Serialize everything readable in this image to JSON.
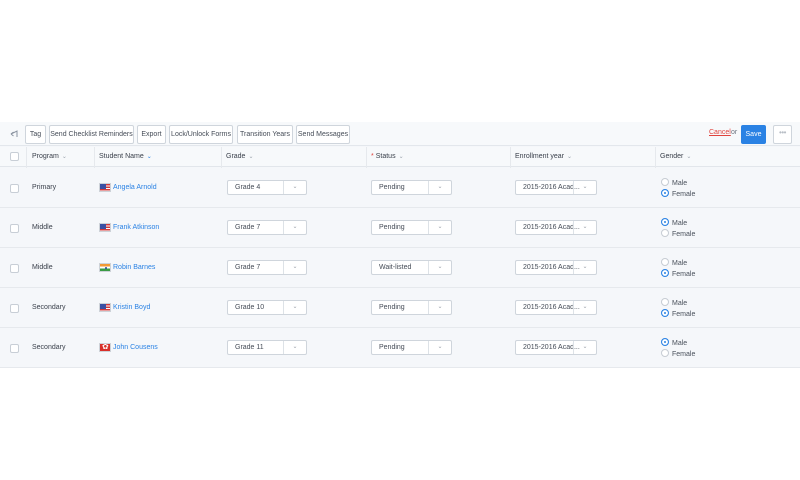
{
  "toolbar": {
    "buttons": [
      "Tag",
      "Send Checklist Reminders",
      "Export",
      "Lock/Unlock Forms",
      "Transition Years",
      "Send Messages"
    ],
    "cancel_label": "Cancel",
    "or_label": "or",
    "save_label": "Save",
    "more_label": "•••",
    "back_icon": "back-arrow-icon"
  },
  "table": {
    "columns": {
      "program": "Program",
      "student_name": "Student Name",
      "grade": "Grade",
      "status": "Status",
      "enrollment_year": "Enrollment year",
      "gender": "Gender"
    },
    "required_mark": "*",
    "gender_options": [
      "Male",
      "Female"
    ],
    "rows": [
      {
        "program": "Primary",
        "name": "Angela Arnold",
        "flag": "us-flag-icon",
        "grade": "Grade 4",
        "status": "Pending",
        "enrollment_year": "2015-2016 Acad...",
        "gender": "Female"
      },
      {
        "program": "Middle",
        "name": "Frank Atkinson",
        "flag": "us-flag-icon",
        "grade": "Grade 7",
        "status": "Pending",
        "enrollment_year": "2015-2016 Acad...",
        "gender": "Male"
      },
      {
        "program": "Middle",
        "name": "Robin Barnes",
        "flag": "india-flag-icon",
        "grade": "Grade 7",
        "status": "Wait-listed",
        "enrollment_year": "2015-2016 Acad...",
        "gender": "Female"
      },
      {
        "program": "Secondary",
        "name": "Kristin Boyd",
        "flag": "us-flag-icon",
        "grade": "Grade 10",
        "status": "Pending",
        "enrollment_year": "2015-2016 Acad...",
        "gender": "Female"
      },
      {
        "program": "Secondary",
        "name": "John Cousens",
        "flag": "hong-kong-flag-icon",
        "grade": "Grade 11",
        "status": "Pending",
        "enrollment_year": "2015-2016 Acad...",
        "gender": "Male"
      }
    ]
  },
  "colors": {
    "accent": "#2a82e4",
    "danger": "#e0433d"
  }
}
